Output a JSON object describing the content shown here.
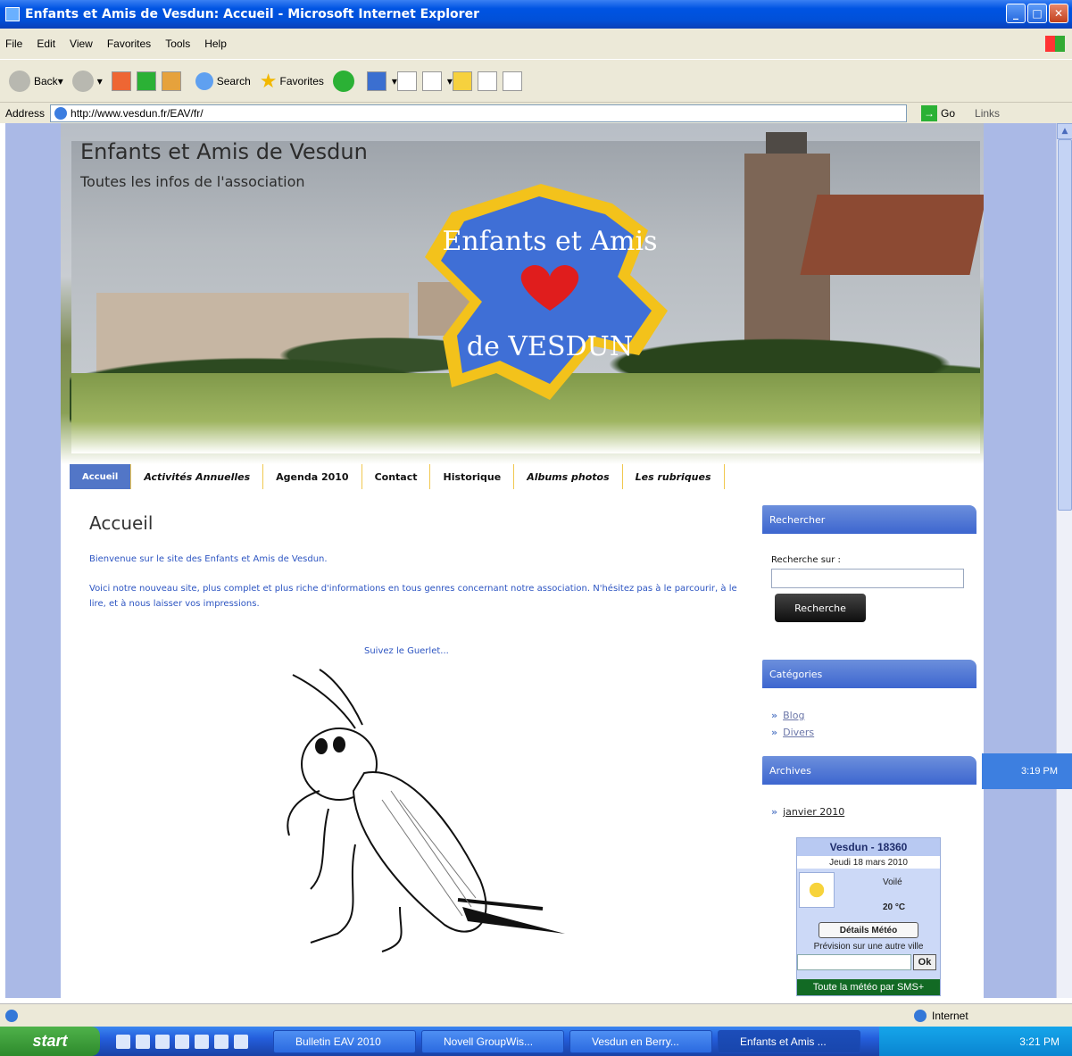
{
  "window": {
    "title": "Enfants et Amis de Vesdun: Accueil - Microsoft Internet Explorer"
  },
  "menu": [
    "File",
    "Edit",
    "View",
    "Favorites",
    "Tools",
    "Help"
  ],
  "toolbar": {
    "back": "Back",
    "search": "Search",
    "favorites": "Favorites"
  },
  "address": {
    "label": "Address",
    "url": "http://www.vesdun.fr/EAV/fr/",
    "go": "Go",
    "links": "Links"
  },
  "site": {
    "title": "Enfants et Amis de Vesdun",
    "subtitle": "Toutes les infos de l'association",
    "logo_text_1": "Enfants et Amis",
    "logo_text_2": "de VESDUN",
    "nav": [
      "Accueil",
      "Activités Annuelles",
      "Agenda 2010",
      "Contact",
      "Historique",
      "Albums photos",
      "Les rubriques"
    ]
  },
  "main": {
    "heading": "Accueil",
    "p1": "Bienvenue sur le site des Enfants et Amis de Vesdun.",
    "p2": "Voici notre nouveau site, plus complet et plus riche d'informations en tous genres concernant notre association. N'hésitez pas à le parcourir, à le lire, et à nous laisser vos impressions.",
    "center": "Suivez le Guerlet..."
  },
  "sidebar": {
    "search_title": "Rechercher",
    "search_label": "Recherche sur :",
    "search_button": "Recherche",
    "categories_title": "Catégories",
    "categories": [
      "Blog",
      "Divers"
    ],
    "archives_title": "Archives",
    "archives": [
      "janvier 2010"
    ],
    "weather": {
      "place": "Vesdun - 18360",
      "date": "Jeudi 18 mars 2010",
      "desc": "Voilé",
      "temp": "20 °C",
      "details": "Détails Météo",
      "other": "Prévision sur une autre ville",
      "ok": "Ok",
      "sms": "Toute la météo par SMS+"
    }
  },
  "overlay": {
    "time": "3:19 PM"
  },
  "status": {
    "zone": "Internet"
  },
  "taskbar": {
    "start": "start",
    "tasks": [
      "Bulletin EAV 2010",
      "Novell GroupWis...",
      "Vesdun en Berry...",
      "Enfants et Amis ..."
    ],
    "time": "3:21 PM"
  },
  "colors": {
    "accent": "#5276c7",
    "link": "#2d55c2",
    "nav_divider": "#f1c84f"
  }
}
